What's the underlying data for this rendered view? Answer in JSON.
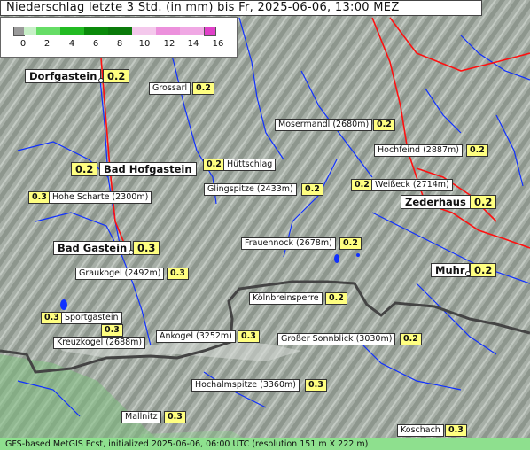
{
  "title": "Niederschlag letzte 3 Std. (in mm) bis Fr, 2025-06-06, 13:00 MEZ",
  "legend": {
    "ticks": [
      "0",
      "2",
      "4",
      "6",
      "8",
      "10",
      "12",
      "14",
      "16"
    ],
    "colors": [
      "#9a9a9a",
      "#c8f0c8",
      "#66dd66",
      "#22bb22",
      "#0a8a0a",
      "#f4c8ec",
      "#ec90dc",
      "#e040c8"
    ]
  },
  "places": [
    {
      "name": "Dorfgastein",
      "value": "0.2",
      "big": true
    },
    {
      "name": "Grossarl",
      "value": "0.2"
    },
    {
      "name": "Mosermandl (2680m)",
      "value": "0.2"
    },
    {
      "name": "Hochfeind (2887m)",
      "value": "0.2"
    },
    {
      "name": "Bad Hofgastein",
      "value": "0.2",
      "big": true
    },
    {
      "name": "Hüttschlag",
      "value": "0.2"
    },
    {
      "name": "Hohe Scharte (2300m)",
      "value": "0.3"
    },
    {
      "name": "Glingspitze (2433m)",
      "value": "0.2"
    },
    {
      "name": "Weißeck (2714m)",
      "value": "0.2"
    },
    {
      "name": "Zederhaus",
      "value": "0.2",
      "big": true
    },
    {
      "name": "Frauennock (2678m)",
      "value": "0.2"
    },
    {
      "name": "Bad Gastein",
      "value": "0.3",
      "big": true
    },
    {
      "name": "Graukogel (2492m)",
      "value": "0.3"
    },
    {
      "name": "Muhr",
      "value": "0.2",
      "big": true
    },
    {
      "name": "Kölnbreinsperre",
      "value": "0.2"
    },
    {
      "name": "Sportgastein",
      "value": "0.3"
    },
    {
      "name": "Kreuzkogel (2688m)",
      "value": "0.3"
    },
    {
      "name": "Ankogel (3252m)",
      "value": "0.3"
    },
    {
      "name": "Großer Sonnblick (3030m)",
      "value": "0.2"
    },
    {
      "name": "Hochalmspitze (3360m)",
      "value": "0.3"
    },
    {
      "name": "Mallnitz",
      "value": "0.3"
    },
    {
      "name": "Koschach",
      "value": "0.3"
    }
  ],
  "footer": "GFS-based MetGIS Fcst, initialized 2025-06-06, 06:00 UTC  (resolution 151 m X 222 m)"
}
